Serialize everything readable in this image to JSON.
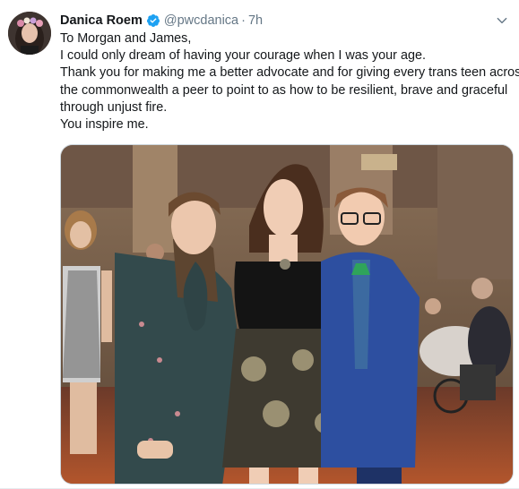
{
  "tweet": {
    "author_name": "Danica Roem",
    "handle": "@pwcdanica",
    "separator": "·",
    "time": "7h",
    "body_lines": [
      "To Morgan and James,",
      "I could only dream of having your courage when I was your age.",
      "Thank you for making me a better advocate and for giving every trans teen across",
      "the commonwealth a peer to point to as how to be resilient, brave and graceful",
      "through unjust fire.",
      "You inspire me."
    ]
  },
  "icons": {
    "verified": "verified-badge-icon",
    "caret": "chevron-down-icon"
  },
  "colors": {
    "verified_blue": "#1da1f2",
    "secondary_text": "#657786",
    "primary_text": "#14171a"
  }
}
